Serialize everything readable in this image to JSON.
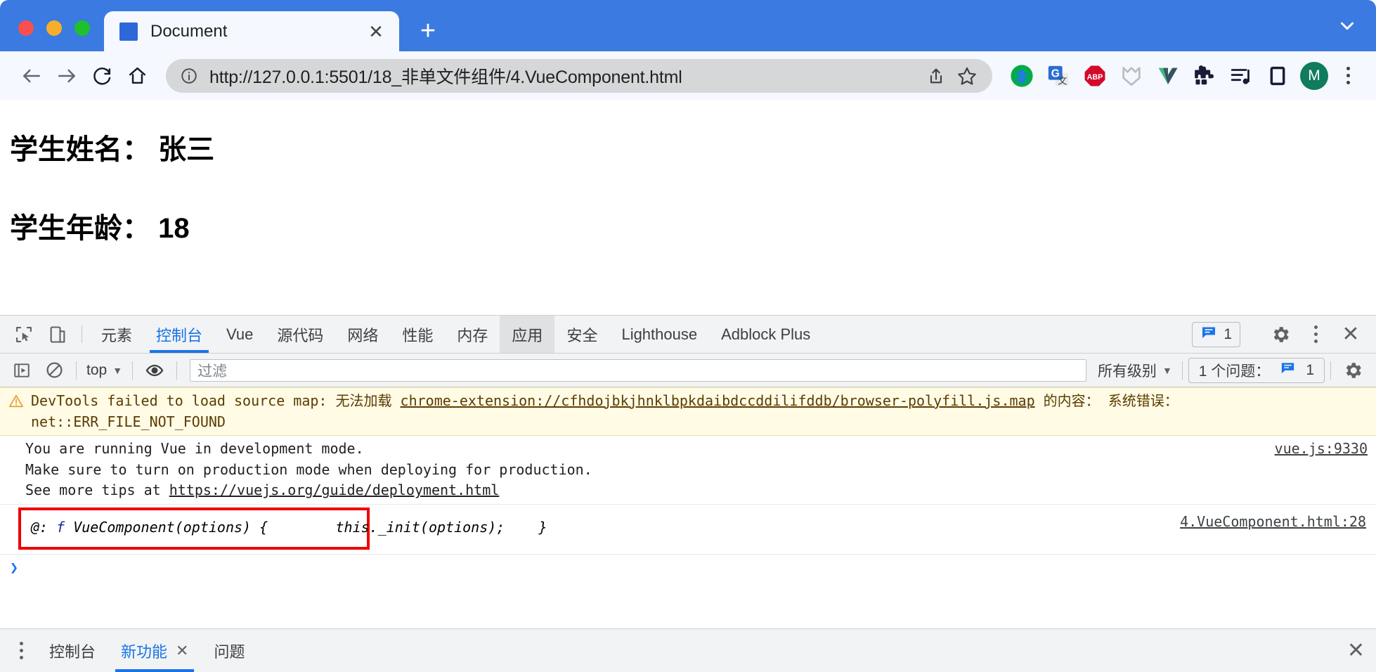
{
  "browser": {
    "tab": {
      "title": "Document",
      "favicon": "blue-square-favicon",
      "close_label": "✕"
    },
    "newtab_label": "+",
    "nav": {
      "back": "back-arrow",
      "forward": "forward-arrow",
      "reload": "reload",
      "home": "home"
    },
    "omnibox": {
      "url": "http://127.0.0.1:5501/18_非单文件组件/4.VueComponent.html",
      "info_icon": "info-circle-icon",
      "share_icon": "share-icon",
      "bookmark_icon": "star-icon"
    },
    "extensions": [
      {
        "name": "tampermonkey",
        "label": ""
      },
      {
        "name": "google-translate",
        "label": "G"
      },
      {
        "name": "adblock-plus",
        "label": "ABP"
      },
      {
        "name": "momentum",
        "label": ""
      },
      {
        "name": "vue-devtools",
        "label": ""
      },
      {
        "name": "extensions-puzzle",
        "label": ""
      },
      {
        "name": "playlist",
        "label": ""
      },
      {
        "name": "reading-list",
        "label": ""
      }
    ],
    "profile_initial": "M"
  },
  "page": {
    "line1": "学生姓名： 张三",
    "line2": "学生年龄： 18"
  },
  "devtools": {
    "tabs": [
      {
        "label": "元素",
        "state": "normal"
      },
      {
        "label": "控制台",
        "state": "active"
      },
      {
        "label": "Vue",
        "state": "normal"
      },
      {
        "label": "源代码",
        "state": "normal"
      },
      {
        "label": "网络",
        "state": "normal"
      },
      {
        "label": "性能",
        "state": "normal"
      },
      {
        "label": "内存",
        "state": "normal"
      },
      {
        "label": "应用",
        "state": "hovered"
      },
      {
        "label": "安全",
        "state": "normal"
      },
      {
        "label": "Lighthouse",
        "state": "normal"
      },
      {
        "label": "Adblock Plus",
        "state": "normal"
      }
    ],
    "issues_count": "1",
    "filterbar": {
      "context": "top",
      "filter_placeholder": "过滤",
      "level": "所有级别",
      "issues_label": "1 个问题：",
      "issues_count": "1"
    },
    "console": {
      "warning": {
        "text_before_link": "DevTools failed to load source map: 无法加载 ",
        "link": "chrome-extension://cfhdojbkjhnklbpkdaibdccddilifddb/browser-polyfill.js.map",
        "text_after_link": " 的内容： 系统错误： net::ERR_FILE_NOT_FOUND"
      },
      "vue_message": {
        "line1": "You are running Vue in development mode.",
        "line2": "Make sure to turn on production mode when deploying for production.",
        "line3_prefix": "See more tips at ",
        "line3_link": "https://vuejs.org/guide/deployment.html",
        "source": "vue.js:9330"
      },
      "boxed_output": {
        "label": "@:",
        "keyword": "f",
        "signature": " VueComponent(options) {",
        "body": "        this._init(options);",
        "close": "    }",
        "source": "4.VueComponent.html:28"
      },
      "prompt_caret": "❯"
    },
    "drawer": {
      "tabs": [
        {
          "label": "控制台",
          "active": false,
          "closable": false
        },
        {
          "label": "新功能",
          "active": true,
          "closable": true
        },
        {
          "label": "问题",
          "active": false,
          "closable": false
        }
      ],
      "close_label": "✕"
    },
    "close_label": "✕"
  },
  "colors": {
    "chrome_blue": "#3b7ae0",
    "devtools_accent": "#1a73e8",
    "warning_bg": "#fffbe5",
    "highlight_box": "#ee0000"
  }
}
